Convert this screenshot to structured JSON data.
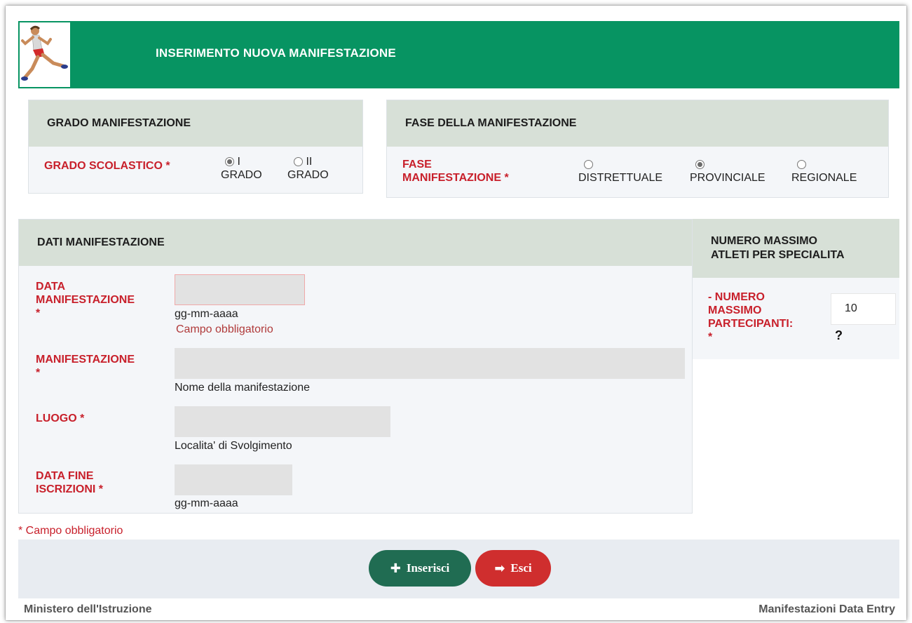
{
  "header": {
    "title": "INSERIMENTO NUOVA MANIFESTAZIONE"
  },
  "grado": {
    "heading": "GRADO MANIFESTAZIONE",
    "label": "GRADO SCOLASTICO *",
    "options": [
      {
        "line1": "I",
        "line2": "GRADO",
        "checked": true
      },
      {
        "line1": "II",
        "line2": "GRADO",
        "checked": false
      }
    ]
  },
  "fase": {
    "heading": "FASE DELLA MANIFESTAZIONE",
    "label_line1": "FASE",
    "label_line2": "MANIFESTAZIONE *",
    "options": [
      {
        "label": "DISTRETTUALE",
        "checked": false
      },
      {
        "label": "PROVINCIALE",
        "checked": true
      },
      {
        "label": "REGIONALE",
        "checked": false
      }
    ]
  },
  "dati": {
    "heading": "DATI MANIFESTAZIONE",
    "data_label_1": "DATA",
    "data_label_2": "MANIFESTAZIONE",
    "data_label_3": "*",
    "data_hint": "gg-mm-aaaa",
    "data_error": "Campo obbligatorio",
    "manif_label_1": "MANIFESTAZIONE",
    "manif_label_2": "*",
    "manif_hint": "Nome della manifestazione",
    "luogo_label": "LUOGO *",
    "luogo_hint": "Localita' di Svolgimento",
    "fine_label_1": "DATA FINE",
    "fine_label_2": "ISCRIZIONI *",
    "fine_hint": "gg-mm-aaaa"
  },
  "numero": {
    "heading_1": "NUMERO MASSIMO",
    "heading_2": "ATLETI PER SPECIALITA",
    "label_1": "- NUMERO",
    "label_2": "MASSIMO",
    "label_3": "PARTECIPANTI:",
    "label_4": "*",
    "value": "10",
    "help": "?"
  },
  "required_note": "* Campo obbligatorio",
  "buttons": {
    "insert": "Inserisci",
    "exit": "Esci"
  },
  "footer": {
    "left": "Ministero dell'Istruzione",
    "right": "Manifestazioni Data Entry"
  },
  "colors": {
    "header": "#079462",
    "label_red": "#c8202b",
    "btn_insert": "#206c52",
    "btn_exit": "#cf2e2e"
  }
}
